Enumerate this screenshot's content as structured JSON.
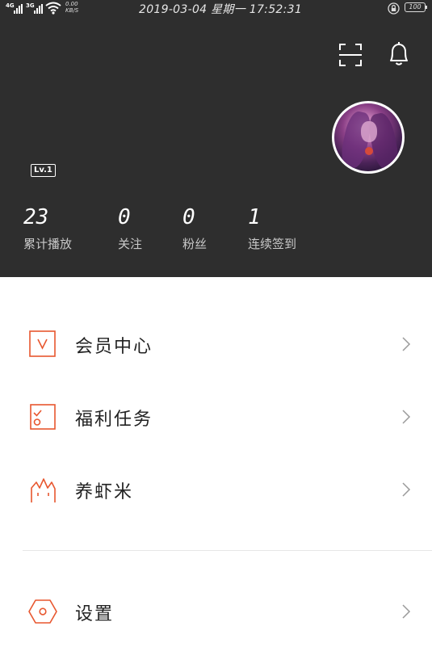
{
  "status_bar": {
    "network_1": "4G",
    "network_2": "3G",
    "speed_value": "0.00",
    "speed_unit": "KB/S",
    "datetime": "2019-03-04 星期一 17:52:31",
    "battery": "100"
  },
  "profile": {
    "level": "Lv.1",
    "stats": [
      {
        "value": "23",
        "label": "累计播放"
      },
      {
        "value": "0",
        "label": "关注"
      },
      {
        "value": "0",
        "label": "粉丝"
      },
      {
        "value": "1",
        "label": "连续签到"
      }
    ]
  },
  "menu": {
    "items": [
      {
        "label": "会员中心",
        "icon": "vip-icon"
      },
      {
        "label": "福利任务",
        "icon": "task-icon"
      },
      {
        "label": "养虾米",
        "icon": "shrimp-icon"
      },
      {
        "label": "设置",
        "icon": "settings-icon"
      }
    ]
  },
  "colors": {
    "header_bg": "#2e2e2e",
    "accent": "#e8572f"
  }
}
